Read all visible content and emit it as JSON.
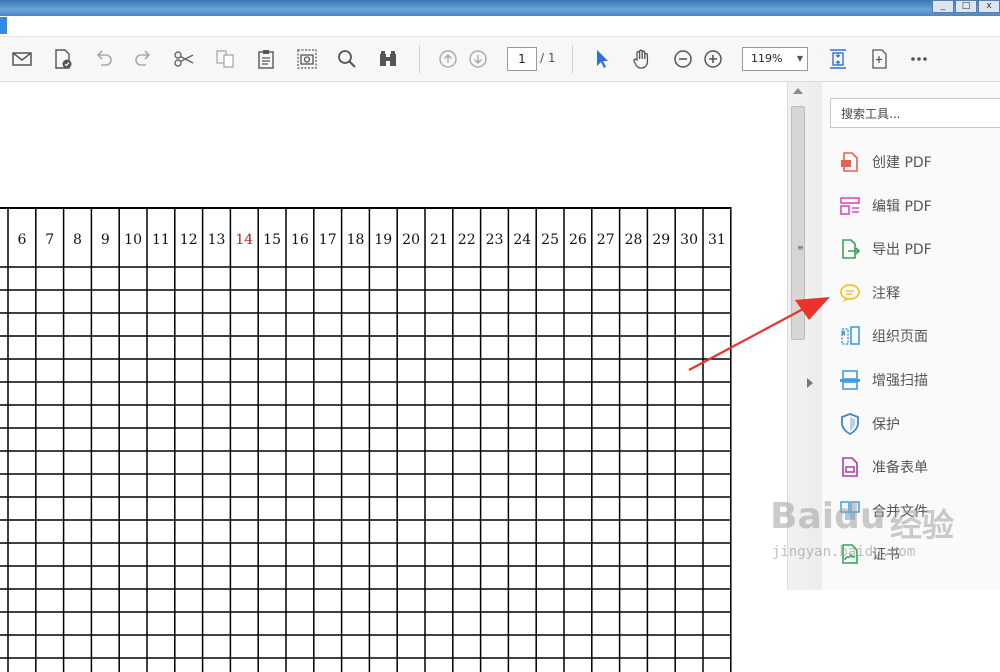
{
  "window": {
    "controls": [
      "_",
      "□",
      "x"
    ]
  },
  "toolbar": {
    "icons": [
      "mail-icon",
      "document-signature-icon",
      "undo-icon",
      "redo-icon",
      "cut-icon",
      "compare-icon",
      "clipboard-icon",
      "snapshot-icon",
      "search-icon",
      "binoculars-icon",
      "page-up-icon",
      "page-down-icon",
      "select-cursor-icon",
      "hand-icon",
      "zoom-out-icon",
      "zoom-in-icon",
      "fit-page-icon",
      "crop-icon",
      "more-icon"
    ],
    "page_current": "1",
    "page_total": "/ 1",
    "zoom": "119%"
  },
  "grid": {
    "headers": [
      "6",
      "7",
      "8",
      "9",
      "10",
      "11",
      "12",
      "13",
      "14",
      "15",
      "16",
      "17",
      "18",
      "19",
      "20",
      "21",
      "22",
      "23",
      "24",
      "25",
      "26",
      "27",
      "28",
      "29",
      "30",
      "31"
    ],
    "header_red": [
      "14"
    ]
  },
  "panel": {
    "search_placeholder": "搜索工具...",
    "tools": [
      {
        "label": "创建 PDF",
        "icon": "create-pdf-icon",
        "color": "#e8604c"
      },
      {
        "label": "编辑 PDF",
        "icon": "edit-pdf-icon",
        "color": "#d94fb6"
      },
      {
        "label": "导出 PDF",
        "icon": "export-pdf-icon",
        "color": "#3aa35a"
      },
      {
        "label": "注释",
        "icon": "comment-icon",
        "color": "#f2c12e"
      },
      {
        "label": "组织页面",
        "icon": "organize-pages-icon",
        "color": "#3e9ee0"
      },
      {
        "label": "增强扫描",
        "icon": "enhance-scan-icon",
        "color": "#3e9ee0"
      },
      {
        "label": "保护",
        "icon": "protect-icon",
        "color": "#3a86d6"
      },
      {
        "label": "准备表单",
        "icon": "prepare-form-icon",
        "color": "#b03aa8"
      },
      {
        "label": "合并文件",
        "icon": "combine-files-icon",
        "color": "#3e9ee0"
      },
      {
        "label": "证书",
        "icon": "certificate-icon",
        "color": "#3aa35a"
      }
    ]
  },
  "watermark": {
    "brand": "Baidu",
    "brand_cn": "经验",
    "url": "jingyan.baidu.com"
  },
  "colors": {
    "accent": "#2f8ce8",
    "annotation_arrow": "#e8342b"
  }
}
